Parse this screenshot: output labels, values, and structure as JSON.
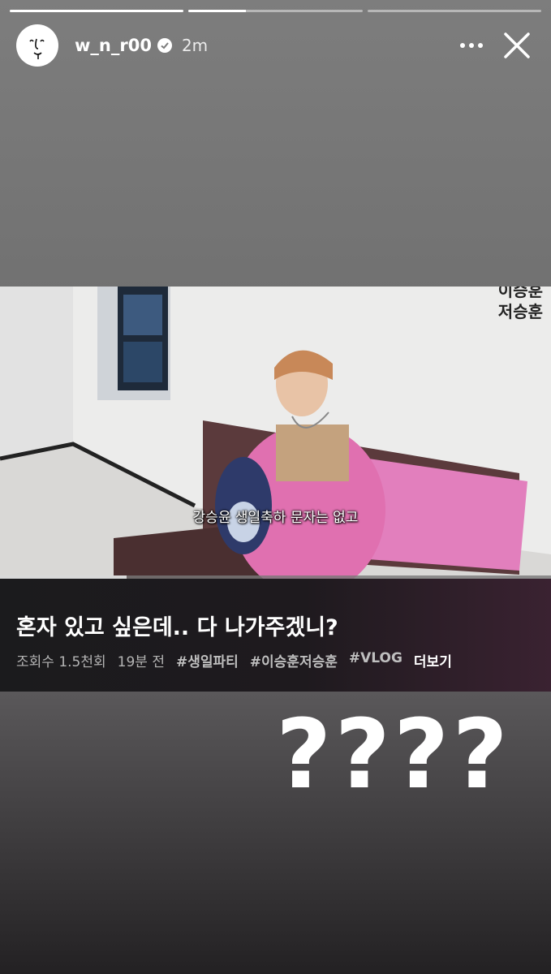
{
  "story": {
    "progress_segments": [
      1.0,
      0.33,
      0.0
    ],
    "user": {
      "username": "w_n_r00",
      "verified": true,
      "time": "2m"
    },
    "icons": {
      "more": "more-horizontal-icon",
      "close": "close-icon",
      "verified": "verified-badge-icon"
    }
  },
  "video": {
    "watermark": [
      "이승훈",
      "저승훈"
    ],
    "subtitle": "강승윤 생일축하 문자는 없고",
    "progress": 0.23,
    "title": "혼자 있고 싶은데.. 다 나가주겠니?",
    "views": "조회수 1.5천회",
    "uploaded": "19분 전",
    "tags": [
      "#생일파티",
      "#이승훈저승훈",
      "#VLOG"
    ],
    "more_label": "더보기"
  },
  "overlay_text": "????",
  "colors": {
    "pink_jacket": "#e070b0",
    "bench_pink": "#e27fbd",
    "info_bg": "#1e1a1e"
  }
}
